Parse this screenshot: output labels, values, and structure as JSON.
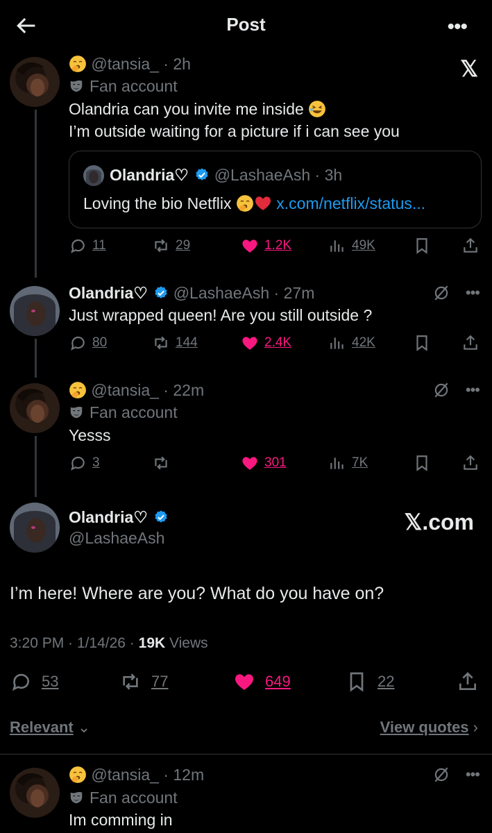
{
  "header": {
    "title": "Post"
  },
  "top_right_logo": "𝕏",
  "posts": [
    {
      "handle": "@tansia_",
      "time": "2h",
      "badge": "Fan account",
      "text_line1": "Olandria can you invite me inside",
      "text_line2": "I’m outside waiting for a picture if i can see you",
      "quote": {
        "name": "Olandria♡",
        "handle": "@LashaeAsh",
        "time": "3h",
        "text": "Loving the bio Netflix",
        "link": "x.com/netflix/status..."
      },
      "stats": {
        "replies": "11",
        "reposts": "29",
        "likes": "1.2K",
        "views": "49K"
      }
    },
    {
      "name": "Olandria♡",
      "handle": "@LashaeAsh",
      "time": "27m",
      "text": "Just wrapped queen! Are you still outside ?",
      "stats": {
        "replies": "80",
        "reposts": "144",
        "likes": "2.4K",
        "views": "42K"
      }
    },
    {
      "handle": "@tansia_",
      "time": "22m",
      "badge": "Fan account",
      "text": "Yesss",
      "stats": {
        "replies": "3",
        "reposts": "",
        "likes": "301",
        "views": "7K"
      }
    }
  ],
  "main_post": {
    "name": "Olandria♡",
    "handle": "@LashaeAsh",
    "watermark": "𝕏.com",
    "text": "I’m here! Where are you? What do you have on?",
    "time": "3:20 PM",
    "date": "1/14/26",
    "views_count": "19K",
    "views_label": "Views",
    "stats": {
      "replies": "53",
      "reposts": "77",
      "likes": "649",
      "bookmarks": "22"
    }
  },
  "filters": {
    "sort": "Relevant",
    "view_quotes": "View quotes"
  },
  "reply": {
    "handle": "@tansia_",
    "time": "12m",
    "badge": "Fan account",
    "text": "Im comming in"
  },
  "colors": {
    "like": "#f91880",
    "link": "#1d9bf0",
    "verified": "#1d9bf0",
    "muted": "#71767b"
  }
}
